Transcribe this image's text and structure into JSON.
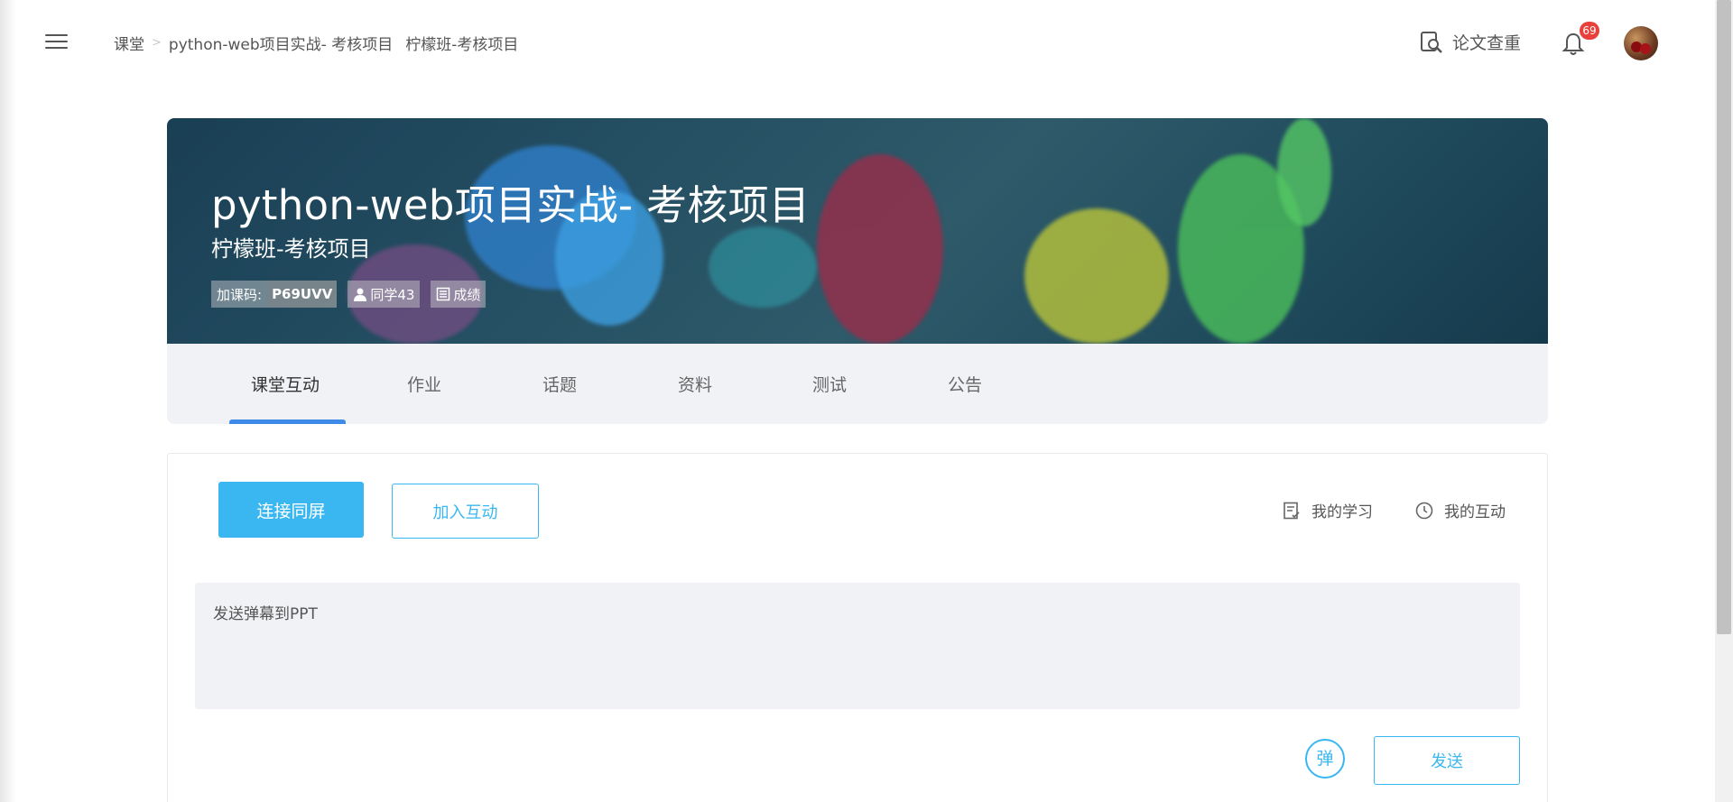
{
  "header": {
    "breadcrumb": [
      "课堂",
      "python-web项目实战- 考核项目",
      "柠檬班-考核项目"
    ],
    "paper_check_label": "论文查重",
    "notification_count": "69"
  },
  "course": {
    "title": "python-web项目实战- 考核项目",
    "class_name": "柠檬班-考核项目",
    "join_code_label": "加课码:",
    "join_code": "P69UVV",
    "students_label": "同学43",
    "grades_label": "成绩"
  },
  "tabs": [
    {
      "label": "课堂互动",
      "active": true
    },
    {
      "label": "作业"
    },
    {
      "label": "话题"
    },
    {
      "label": "资料"
    },
    {
      "label": "测试"
    },
    {
      "label": "公告"
    }
  ],
  "interaction": {
    "connect_label": "连接同屏",
    "join_label": "加入互动",
    "my_study_label": "我的学习",
    "my_interaction_label": "我的互动",
    "danmu_placeholder": "发送弹幕到PPT",
    "danmu_toggle_label": "弹",
    "send_label": "发送"
  },
  "colors": {
    "accent": "#3ab7f0",
    "tab_underline": "#3d8ae8",
    "badge": "#e8403a",
    "tab_bar_bg": "#f0f2f5"
  },
  "icons": [
    "menu-icon",
    "paper-check-icon",
    "bell-icon",
    "person-icon",
    "grades-icon",
    "study-icon",
    "clock-icon"
  ]
}
